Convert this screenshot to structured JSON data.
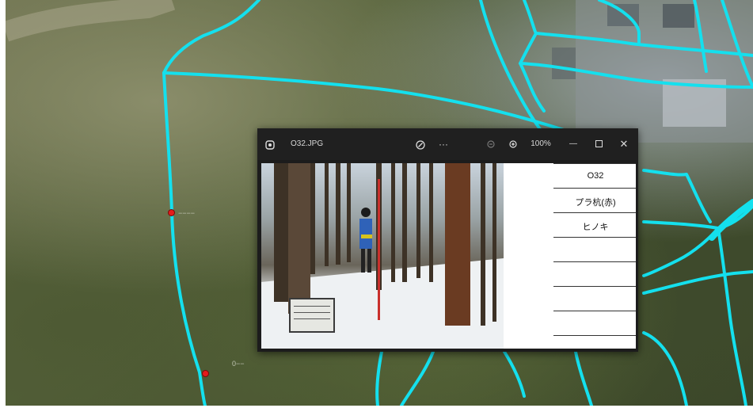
{
  "map": {
    "labels": [
      "−−−−",
      "0−−"
    ]
  },
  "viewer": {
    "filename": "O32.JPG",
    "zoom": "100%",
    "icons": {
      "app": "photos-app-icon",
      "edit": "edit-image-icon",
      "more": "more-options-icon",
      "zoom_out": "zoom-out-icon",
      "zoom_in": "zoom-in-icon",
      "minimize": "minimize-icon",
      "maximize": "maximize-icon",
      "close": "close-icon"
    },
    "form": {
      "rows": [
        "O32",
        "プラ杭(赤)",
        "ヒノキ",
        "",
        "",
        "",
        ""
      ]
    }
  },
  "colors": {
    "boundary_line": "#14e0ee",
    "point_marker": "#e51b1b",
    "titlebar": "#202020"
  }
}
